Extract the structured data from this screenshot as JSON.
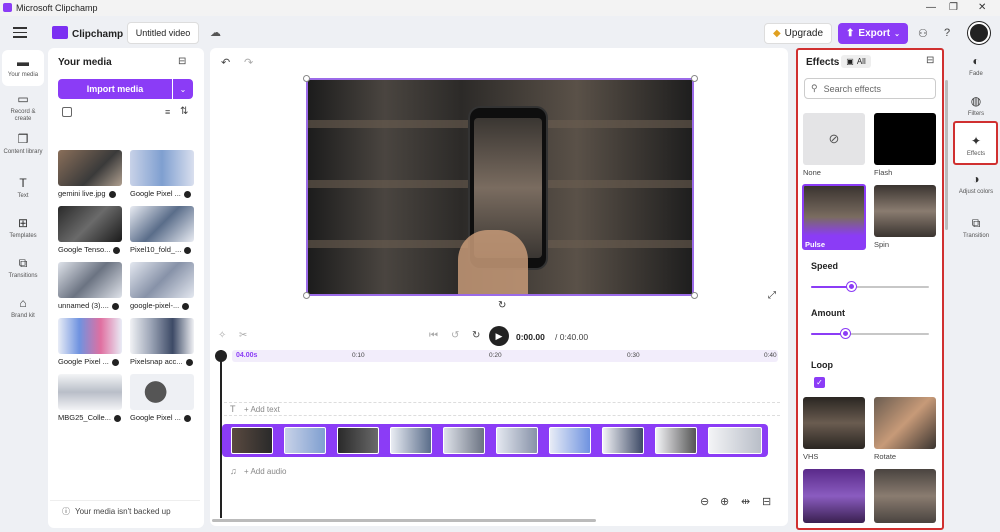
{
  "titlebar": {
    "title": "Microsoft Clipchamp",
    "minimize": "—",
    "restore": "❐",
    "close": "✕"
  },
  "appbar": {
    "brand": "Clipchamp",
    "project_title": "Untitled video",
    "upgrade_label": "Upgrade",
    "export_label": "Export",
    "help": "?"
  },
  "leftnav": [
    {
      "label": "Your media",
      "icon": "folder-icon"
    },
    {
      "label": "Record & create",
      "icon": "camera-icon"
    },
    {
      "label": "Content library",
      "icon": "library-icon"
    },
    {
      "label": "Text",
      "icon": "text-icon"
    },
    {
      "label": "Templates",
      "icon": "templates-icon"
    },
    {
      "label": "Transitions",
      "icon": "transitions-icon"
    },
    {
      "label": "Brand kit",
      "icon": "brand-kit-icon"
    }
  ],
  "media": {
    "heading": "Your media",
    "import_label": "Import media",
    "items": [
      {
        "name": "gemini live.jpg"
      },
      {
        "name": "Google Pixel ..."
      },
      {
        "name": "Google Tenso..."
      },
      {
        "name": "Pixel10_fold_..."
      },
      {
        "name": "unnamed (3)...."
      },
      {
        "name": "google-pixel-..."
      },
      {
        "name": "Google Pixel ..."
      },
      {
        "name": "Pixelsnap acc..."
      },
      {
        "name": "MBG25_Colle..."
      },
      {
        "name": "Google Pixel ..."
      }
    ],
    "backup_text": "Your media isn't backed up"
  },
  "playback": {
    "current": "0:00.00",
    "total": "/ 0:40.00"
  },
  "timeline": {
    "ruler_badge": "04.00s",
    "ticks": [
      "0:10",
      "0:20",
      "0:30",
      "0:40"
    ],
    "add_text": "+ Add text",
    "add_audio": "+ Add audio",
    "clip_count": 12
  },
  "effects": {
    "title": "Effects",
    "filter_all": "All",
    "search_placeholder": "Search effects",
    "items_row1": [
      {
        "label": "None"
      },
      {
        "label": "Flash"
      }
    ],
    "items_row2": [
      {
        "label": "Pulse",
        "selected": true
      },
      {
        "label": "Spin"
      }
    ],
    "speed_label": "Speed",
    "speed_value": 0.35,
    "amount_label": "Amount",
    "amount_value": 0.3,
    "loop_label": "Loop",
    "loop_checked": true,
    "items_row3": [
      {
        "label": "VHS"
      },
      {
        "label": "Rotate"
      }
    ]
  },
  "rightnav": [
    {
      "label": "Fade",
      "icon": "fade-icon"
    },
    {
      "label": "Filters",
      "icon": "filters-icon"
    },
    {
      "label": "Effects",
      "icon": "effects-wand-icon",
      "active": true
    },
    {
      "label": "Adjust colors",
      "icon": "adjust-colors-icon"
    },
    {
      "label": "Transition",
      "icon": "transition-icon"
    }
  ],
  "colors": {
    "accent": "#8b3cf6",
    "highlight_border": "#d03030"
  }
}
